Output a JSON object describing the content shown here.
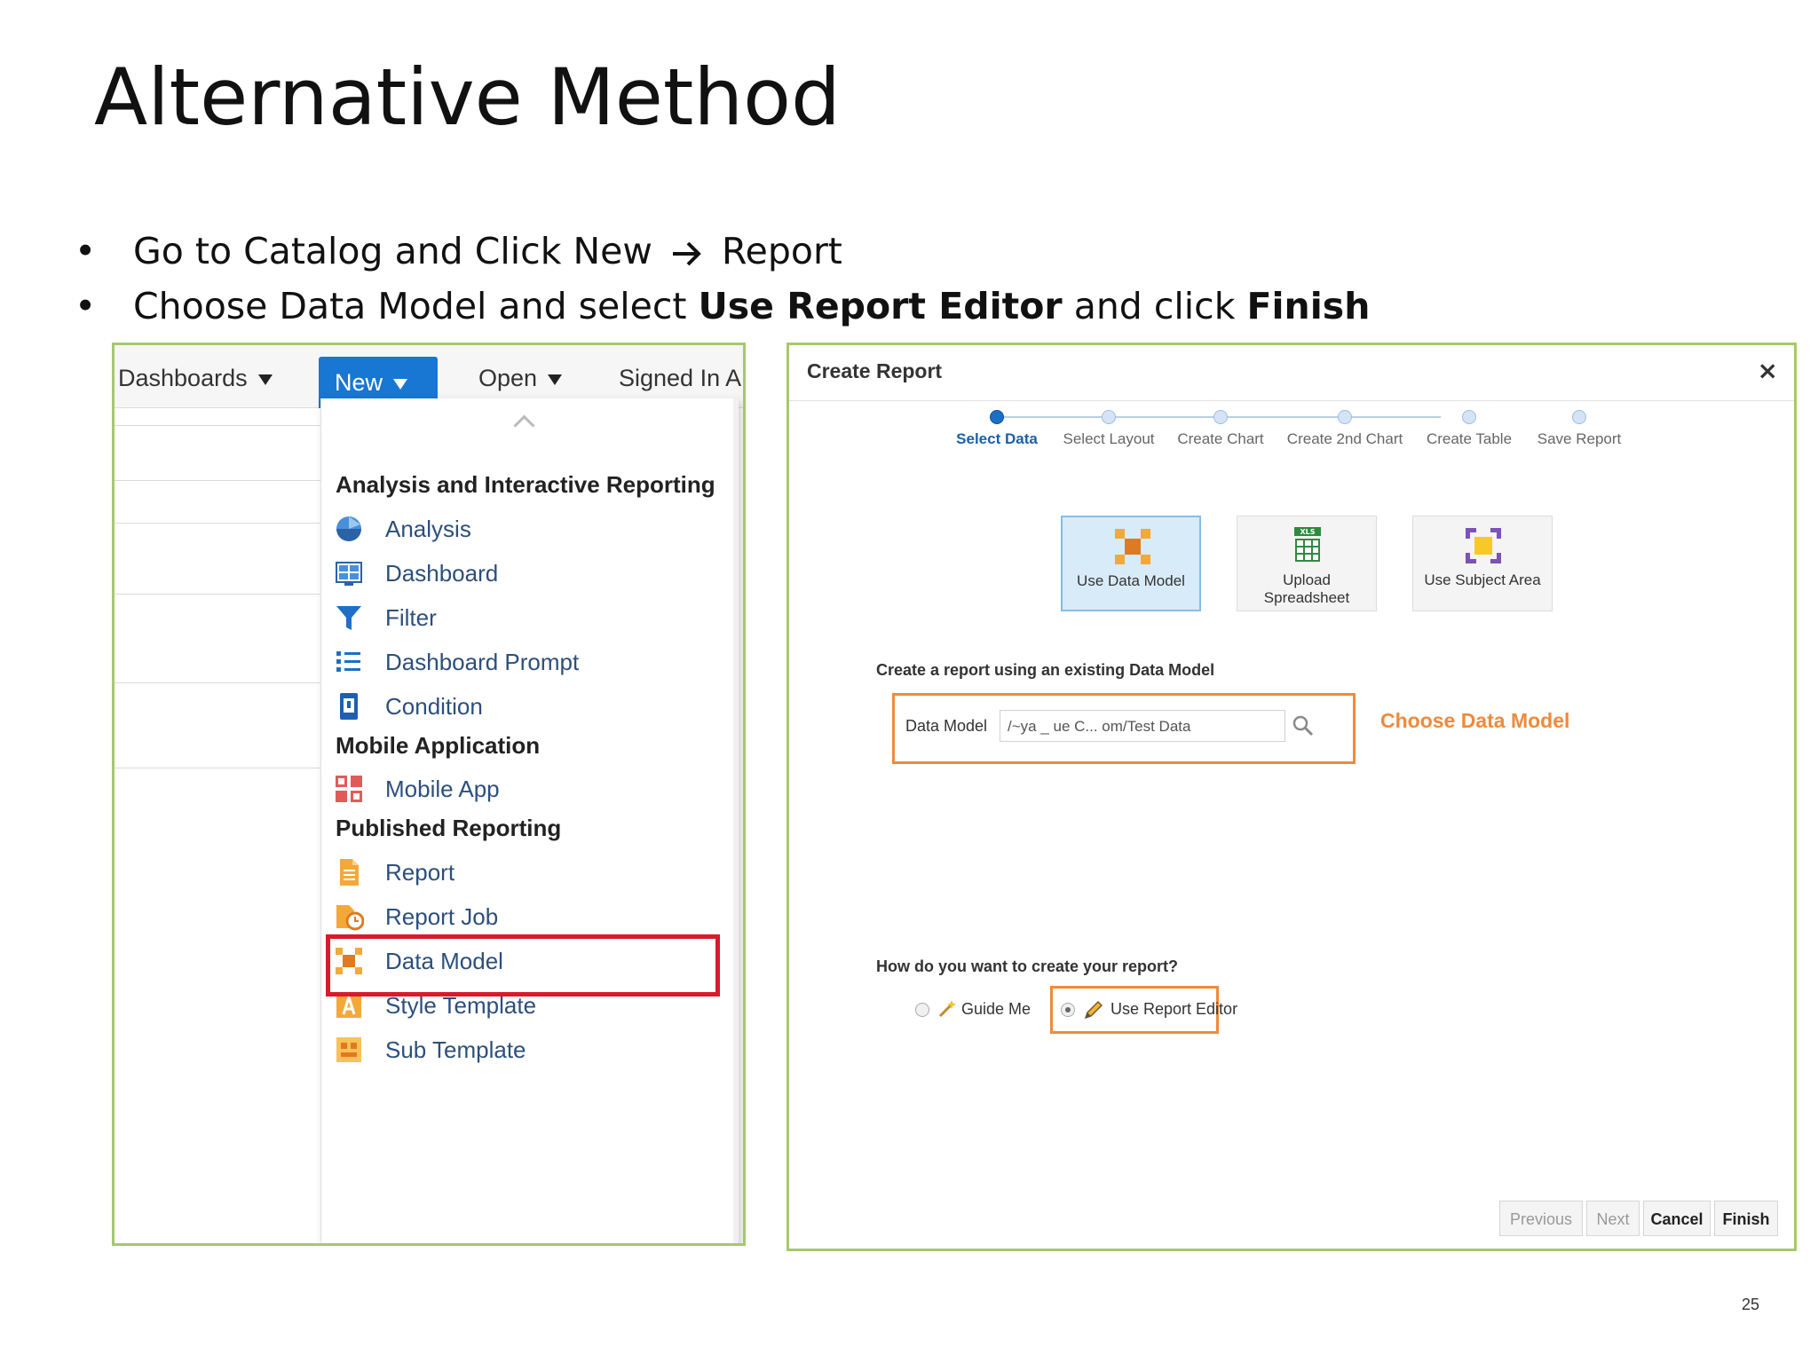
{
  "slide": {
    "title": "Alternative Method",
    "bullets": [
      {
        "before": "Go to Catalog and Click New ",
        "after": " Report"
      },
      {
        "before": "Choose Data Model and select ",
        "bold1": "Use Report Editor",
        "mid": " and click ",
        "bold2": "Finish"
      }
    ],
    "page_number": "25"
  },
  "catalog": {
    "menus": {
      "dashboards": "Dashboards",
      "new": "New",
      "open": "Open",
      "signed_in": "Signed In A"
    },
    "sections": {
      "analysis": "Analysis and Interactive Reporting",
      "mobile": "Mobile Application",
      "published": "Published Reporting"
    },
    "items": {
      "analysis": "Analysis",
      "dashboard": "Dashboard",
      "filter": "Filter",
      "dashboard_prompt": "Dashboard Prompt",
      "condition": "Condition",
      "mobile_app": "Mobile App",
      "report": "Report",
      "report_job": "Report Job",
      "data_model": "Data Model",
      "style_template": "Style Template",
      "sub_template": "Sub Template"
    }
  },
  "dialog": {
    "title": "Create Report",
    "close": "×",
    "train": [
      "Select Data",
      "Select Layout",
      "Create Chart",
      "Create 2nd Chart",
      "Create Table",
      "Save Report"
    ],
    "sources": {
      "use_data_model": "Use Data Model",
      "upload_line1": "Upload",
      "upload_line2": "Spreadsheet",
      "upload_badge": "XLS",
      "subject_area": "Use Subject Area"
    },
    "existing_label": "Create a report using an existing Data Model",
    "data_model_label": "Data Model",
    "data_model_value": "/~ya   _    ue    C...       om/Test Data",
    "choose_callout": "Choose Data Model",
    "how_label": "How do you want to create your report?",
    "guide_me": "Guide Me",
    "use_report_editor": "Use Report Editor",
    "buttons": {
      "previous": "Previous",
      "next": "Next",
      "cancel": "Cancel",
      "finish": "Finish"
    }
  },
  "colors": {
    "frame_green": "#a5c96a",
    "new_blue": "#1877d2",
    "highlight_red": "#d81b2b",
    "callout_orange": "#ef8a3b",
    "link_blue": "#2c4f7c"
  }
}
